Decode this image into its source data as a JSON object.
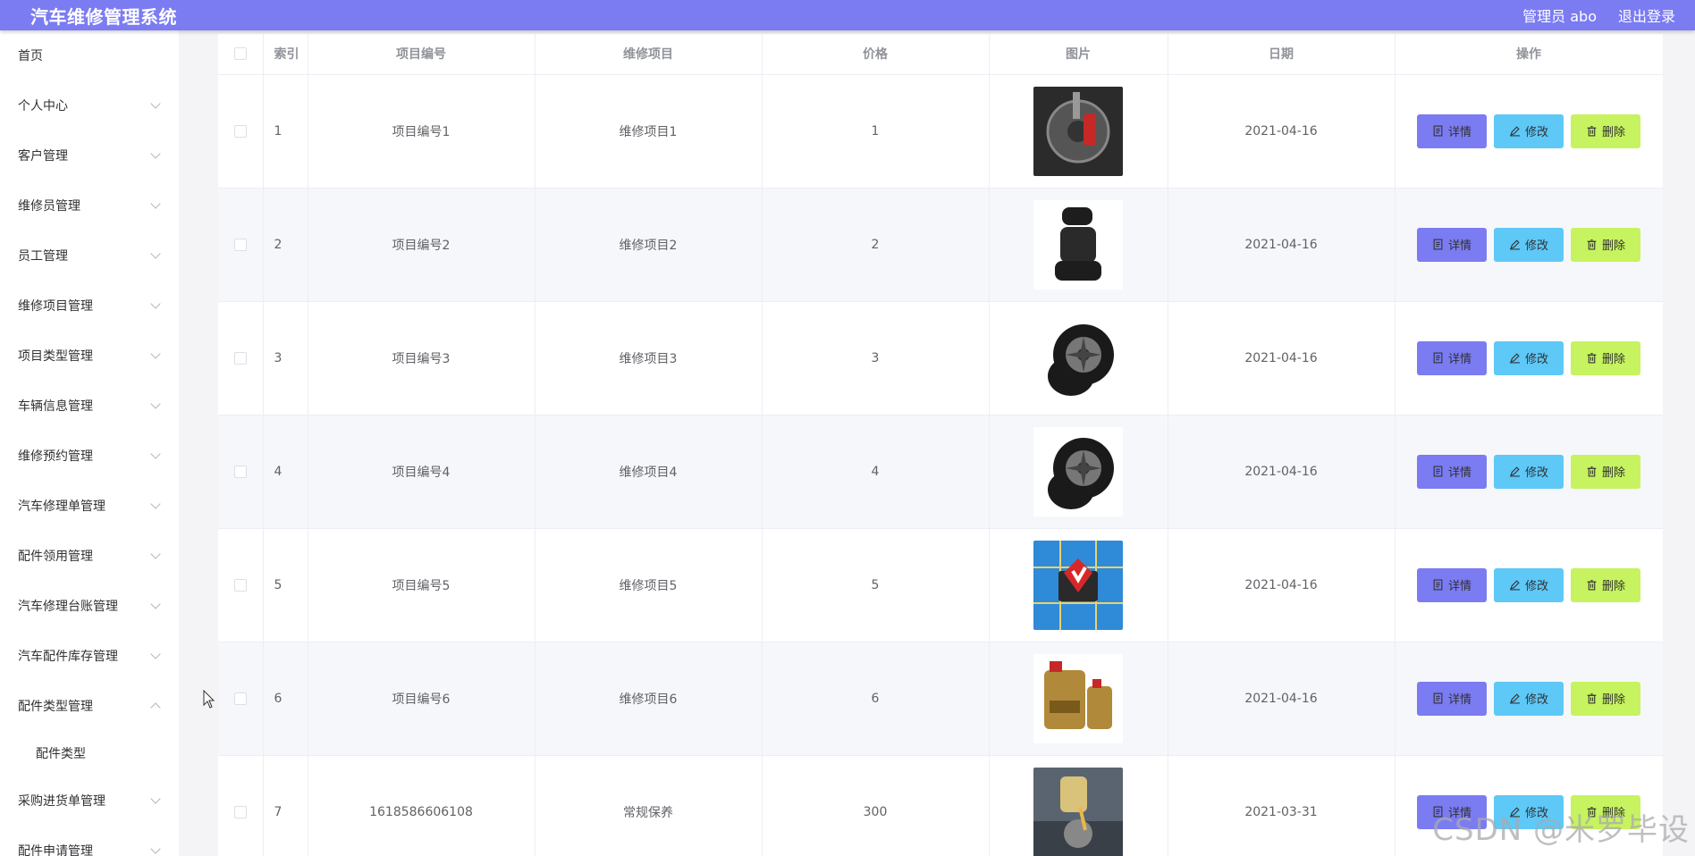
{
  "header": {
    "app_title": "汽车维修管理系统",
    "user_label": "管理员 abo",
    "logout_label": "退出登录"
  },
  "sidebar": {
    "items": [
      {
        "label": "首页",
        "expandable": false
      },
      {
        "label": "个人中心",
        "expandable": true
      },
      {
        "label": "客户管理",
        "expandable": true
      },
      {
        "label": "维修员管理",
        "expandable": true
      },
      {
        "label": "员工管理",
        "expandable": true
      },
      {
        "label": "维修项目管理",
        "expandable": true
      },
      {
        "label": "项目类型管理",
        "expandable": true
      },
      {
        "label": "车辆信息管理",
        "expandable": true
      },
      {
        "label": "维修预约管理",
        "expandable": true
      },
      {
        "label": "汽车修理单管理",
        "expandable": true
      },
      {
        "label": "配件领用管理",
        "expandable": true
      },
      {
        "label": "汽车修理台账管理",
        "expandable": true
      },
      {
        "label": "汽车配件库存管理",
        "expandable": true
      },
      {
        "label": "配件类型管理",
        "expandable": true,
        "expanded": true
      },
      {
        "label": "配件类型",
        "sub": true
      },
      {
        "label": "采购进货单管理",
        "expandable": true
      },
      {
        "label": "配件申请管理",
        "expandable": true
      }
    ]
  },
  "table": {
    "headers": {
      "index": "索引",
      "code": "项目编号",
      "item": "维修项目",
      "price": "价格",
      "image": "图片",
      "date": "日期",
      "actions": "操作"
    },
    "rows": [
      {
        "index": "1",
        "code": "项目编号1",
        "item": "维修项目1",
        "price": "1",
        "date": "2021-04-16",
        "image_icon": "brake-disc-icon"
      },
      {
        "index": "2",
        "code": "项目编号2",
        "item": "维修项目2",
        "price": "2",
        "date": "2021-04-16",
        "image_icon": "car-seat-icon"
      },
      {
        "index": "3",
        "code": "项目编号3",
        "item": "维修项目3",
        "price": "3",
        "date": "2021-04-16",
        "image_icon": "tire-icon"
      },
      {
        "index": "4",
        "code": "项目编号4",
        "item": "维修项目4",
        "price": "4",
        "date": "2021-04-16",
        "image_icon": "tire-icon"
      },
      {
        "index": "5",
        "code": "项目编号5",
        "item": "维修项目5",
        "price": "5",
        "date": "2021-04-16",
        "image_icon": "chip-icon"
      },
      {
        "index": "6",
        "code": "项目编号6",
        "item": "维修项目6",
        "price": "6",
        "date": "2021-04-16",
        "image_icon": "engine-oil-icon"
      },
      {
        "index": "7",
        "code": "1618586606108",
        "item": "常规保养",
        "price": "300",
        "date": "2021-03-31",
        "image_icon": "oil-change-icon"
      }
    ],
    "buttons": {
      "detail": "详情",
      "edit": "修改",
      "delete": "删除"
    }
  },
  "watermark": "CSDN @米罗毕设",
  "colors": {
    "header_bg": "#7b7bf2",
    "detail_btn": "#7b7bf2",
    "edit_btn": "#5ec8f7",
    "delete_btn": "#c6f35f"
  }
}
